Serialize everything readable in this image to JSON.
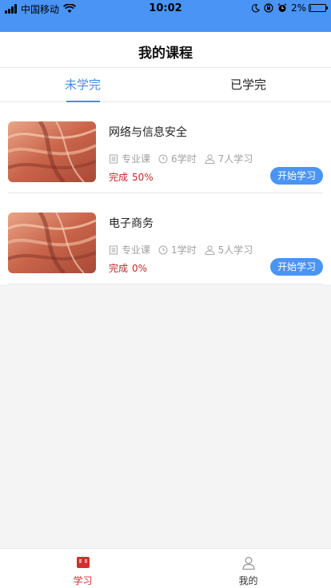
{
  "status_bar": {
    "carrier": "中国移动",
    "time": "10:02",
    "battery": "2%",
    "battery_level": 0.02,
    "icons": [
      "signal-icon",
      "wifi-icon",
      "moon-icon",
      "lock-rotation-icon",
      "alarm-icon",
      "battery-icon"
    ]
  },
  "header": {
    "title": "我的课程"
  },
  "tabs": [
    {
      "label": "未学完",
      "active": true
    },
    {
      "label": "已学完",
      "active": false
    }
  ],
  "courses": [
    {
      "title": "网络与信息安全",
      "category": "专业课",
      "hours": "6学时",
      "learners": "7人学习",
      "progress_label": "完成",
      "progress": "50%",
      "button": "开始学习"
    },
    {
      "title": "电子商务",
      "category": "专业课",
      "hours": "1学时",
      "learners": "5人学习",
      "progress_label": "完成",
      "progress": "0%",
      "button": "开始学习"
    }
  ],
  "tabbar": [
    {
      "label": "学习",
      "icon": "book-icon",
      "active": true
    },
    {
      "label": "我的",
      "icon": "user-icon",
      "active": false
    }
  ],
  "colors": {
    "accent": "#4a94f5",
    "tab_active": "#3f8ee8",
    "progress": "#c02a2a",
    "tabbar_active": "#d32f2f"
  }
}
